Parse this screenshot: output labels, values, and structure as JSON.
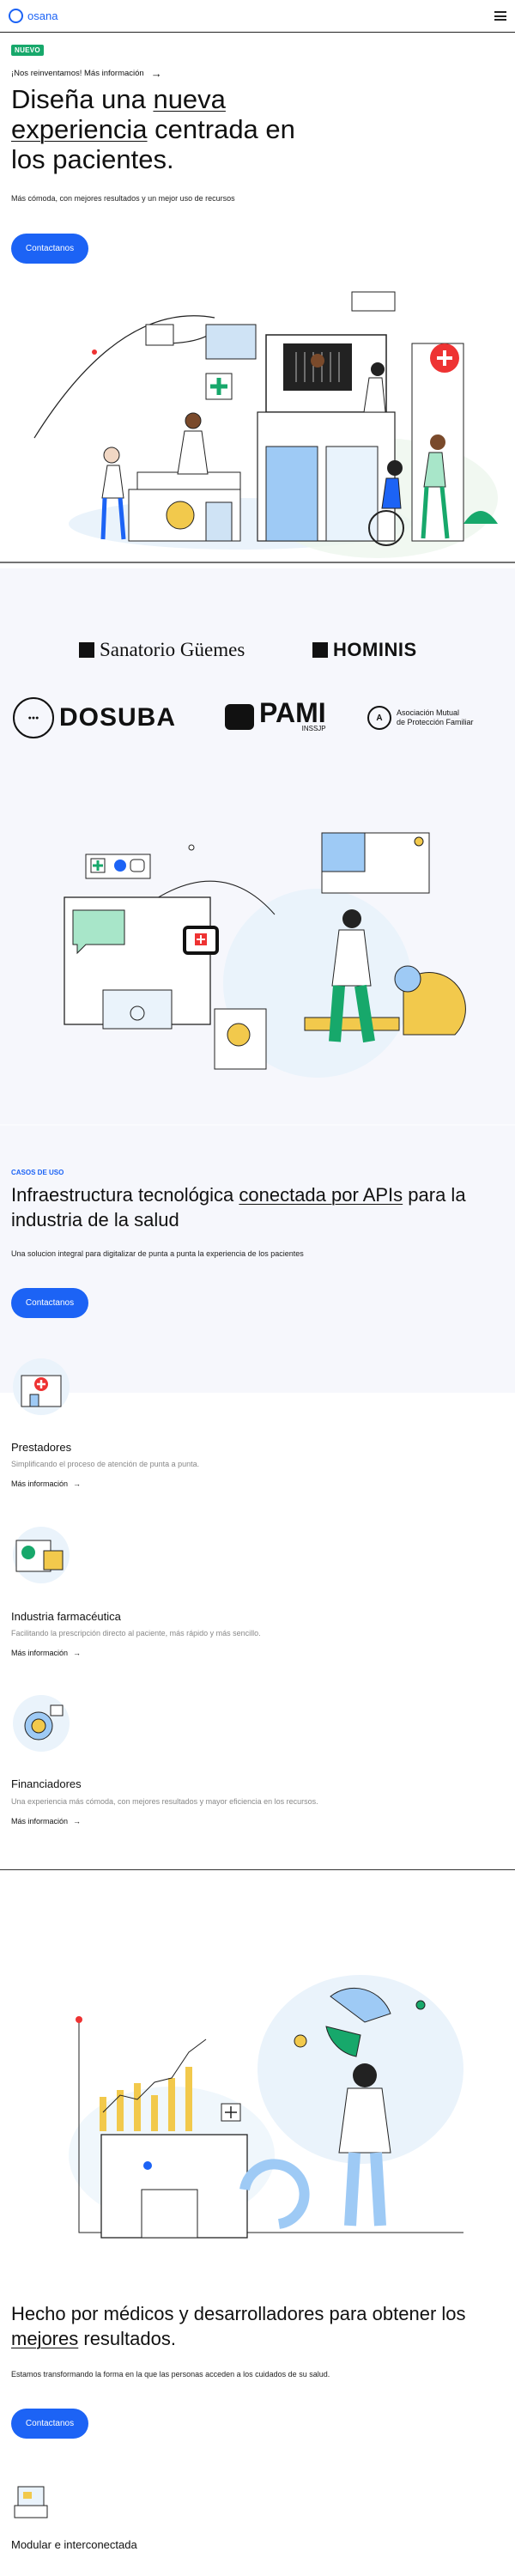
{
  "header": {
    "logo_text": "osana",
    "menu_icon": "hamburger-menu-icon",
    "accent_color": "#1c63f5"
  },
  "hero": {
    "badge": "NUEVO",
    "announcement": "¡Nos reinventamos! Más información",
    "arrow": "→",
    "title_part1": "Diseña una ",
    "title_highlight1": "nueva",
    "title_part2": " ",
    "title_highlight2": "experiencia",
    "title_part3": " centrada en los pacientes.",
    "subtitle": "Más cómoda, con mejores resultados y un mejor uso de recursos",
    "cta": "Contactanos"
  },
  "partners": {
    "sanatorio": "Sanatorio Güemes",
    "hominis": "HOMINIS",
    "dosuba": "DOSUBA",
    "pami": "PAMI",
    "pami_sub": "INSSJP",
    "mutual_line1": "Asociación Mutual",
    "mutual_line2": "de Protección Familiar"
  },
  "api_section": {
    "eyebrow": "CASOS DE USO",
    "title_part1": "Infraestructura tecnológica ",
    "title_highlight": "conectada por APIs",
    "title_part2": " para la industria de la salud",
    "subtitle": "Una solucion integral para digitalizar de punta a punta la experiencia de los pacientes",
    "cta": "Contactanos"
  },
  "features": [
    {
      "icon": "hospital-icon",
      "title": "Prestadores",
      "desc": "Simplificando el proceso de atención de punta a punta.",
      "link": "Más información",
      "arrow": "→"
    },
    {
      "icon": "pharmacy-icon",
      "title": "Industria farmacéutica",
      "desc": "Facilitando la prescripción directo al paciente, más rápido y más sencillo.",
      "link": "Más información",
      "arrow": "→"
    },
    {
      "icon": "coin-icon",
      "title": "Financiadores",
      "desc": "Una experiencia más cómoda, con mejores resultados y mayor eficiencia en los recursos.",
      "link": "Más información",
      "arrow": "→"
    }
  ],
  "doctors_section": {
    "title_part1": "Hecho por médicos y desarrolladores para obtener los ",
    "title_highlight": "mejores",
    "title_part2": " resultados.",
    "subtitle": "Estamos transformando la forma en la que las personas acceden a los cuidados de su salud.",
    "cta": "Contactanos"
  },
  "modular": {
    "icon": "modules-icon",
    "title": "Modular e interconectada"
  }
}
